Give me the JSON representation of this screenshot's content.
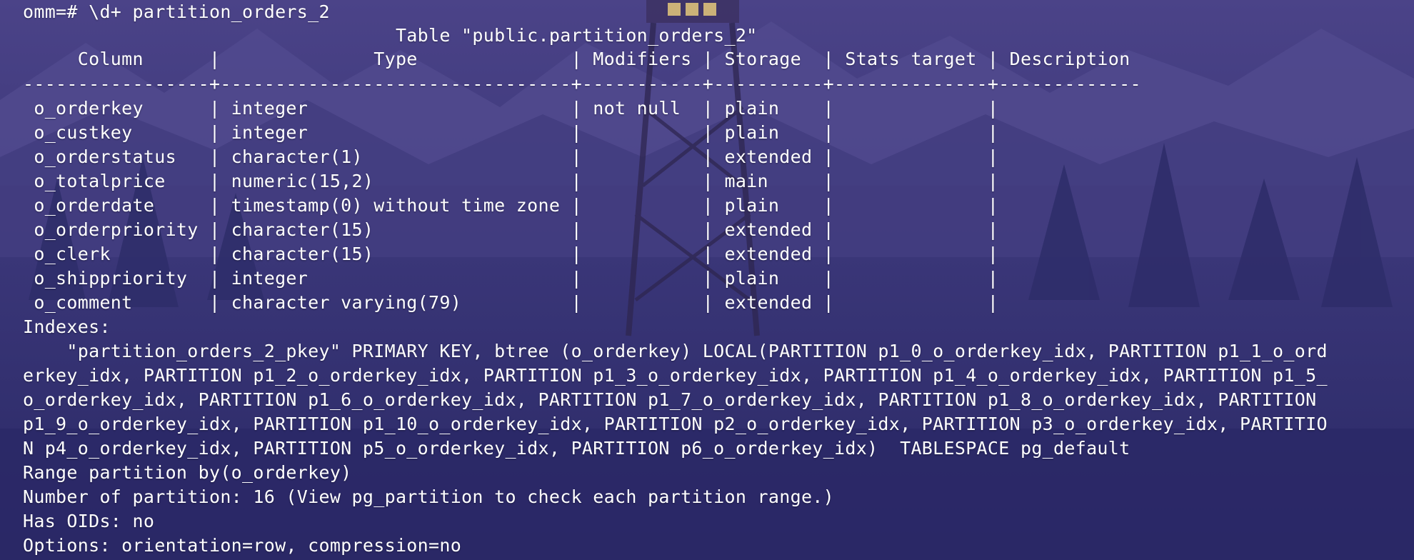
{
  "terminal": {
    "prompt": "omm=# \\d+ partition_orders_2",
    "table_title": "                                  Table \"public.partition_orders_2\"",
    "header_row": "     Column      |              Type              | Modifiers | Storage  | Stats target | Description ",
    "separator_row": "-----------------+--------------------------------+-----------+----------+--------------+-------------",
    "rows": [
      " o_orderkey      | integer                        | not null  | plain    |              | ",
      " o_custkey       | integer                        |           | plain    |              | ",
      " o_orderstatus   | character(1)                   |           | extended |              | ",
      " o_totalprice    | numeric(15,2)                  |           | main     |              | ",
      " o_orderdate     | timestamp(0) without time zone |           | plain    |              | ",
      " o_orderpriority | character(15)                  |           | extended |              | ",
      " o_clerk         | character(15)                  |           | extended |              | ",
      " o_shippriority  | integer                        |           | plain    |              | ",
      " o_comment       | character varying(79)          |           | extended |              | "
    ],
    "indexes_label": "Indexes:",
    "index_lines": [
      "    \"partition_orders_2_pkey\" PRIMARY KEY, btree (o_orderkey) LOCAL(PARTITION p1_0_o_orderkey_idx, PARTITION p1_1_o_ord",
      "erkey_idx, PARTITION p1_2_o_orderkey_idx, PARTITION p1_3_o_orderkey_idx, PARTITION p1_4_o_orderkey_idx, PARTITION p1_5_",
      "o_orderkey_idx, PARTITION p1_6_o_orderkey_idx, PARTITION p1_7_o_orderkey_idx, PARTITION p1_8_o_orderkey_idx, PARTITION ",
      "p1_9_o_orderkey_idx, PARTITION p1_10_o_orderkey_idx, PARTITION p2_o_orderkey_idx, PARTITION p3_o_orderkey_idx, PARTITIO",
      "N p4_o_orderkey_idx, PARTITION p5_o_orderkey_idx, PARTITION p6_o_orderkey_idx)  TABLESPACE pg_default"
    ],
    "footer_lines": [
      "Range partition by(o_orderkey)",
      "Number of partition: 16 (View pg_partition to check each partition range.)",
      "Has OIDs: no",
      "Options: orientation=row, compression=no"
    ]
  },
  "colors": {
    "text": "#ffffff",
    "background_top": "#4a3f86",
    "background_bottom": "#2a2a66",
    "tower_light": "#f7d774"
  }
}
